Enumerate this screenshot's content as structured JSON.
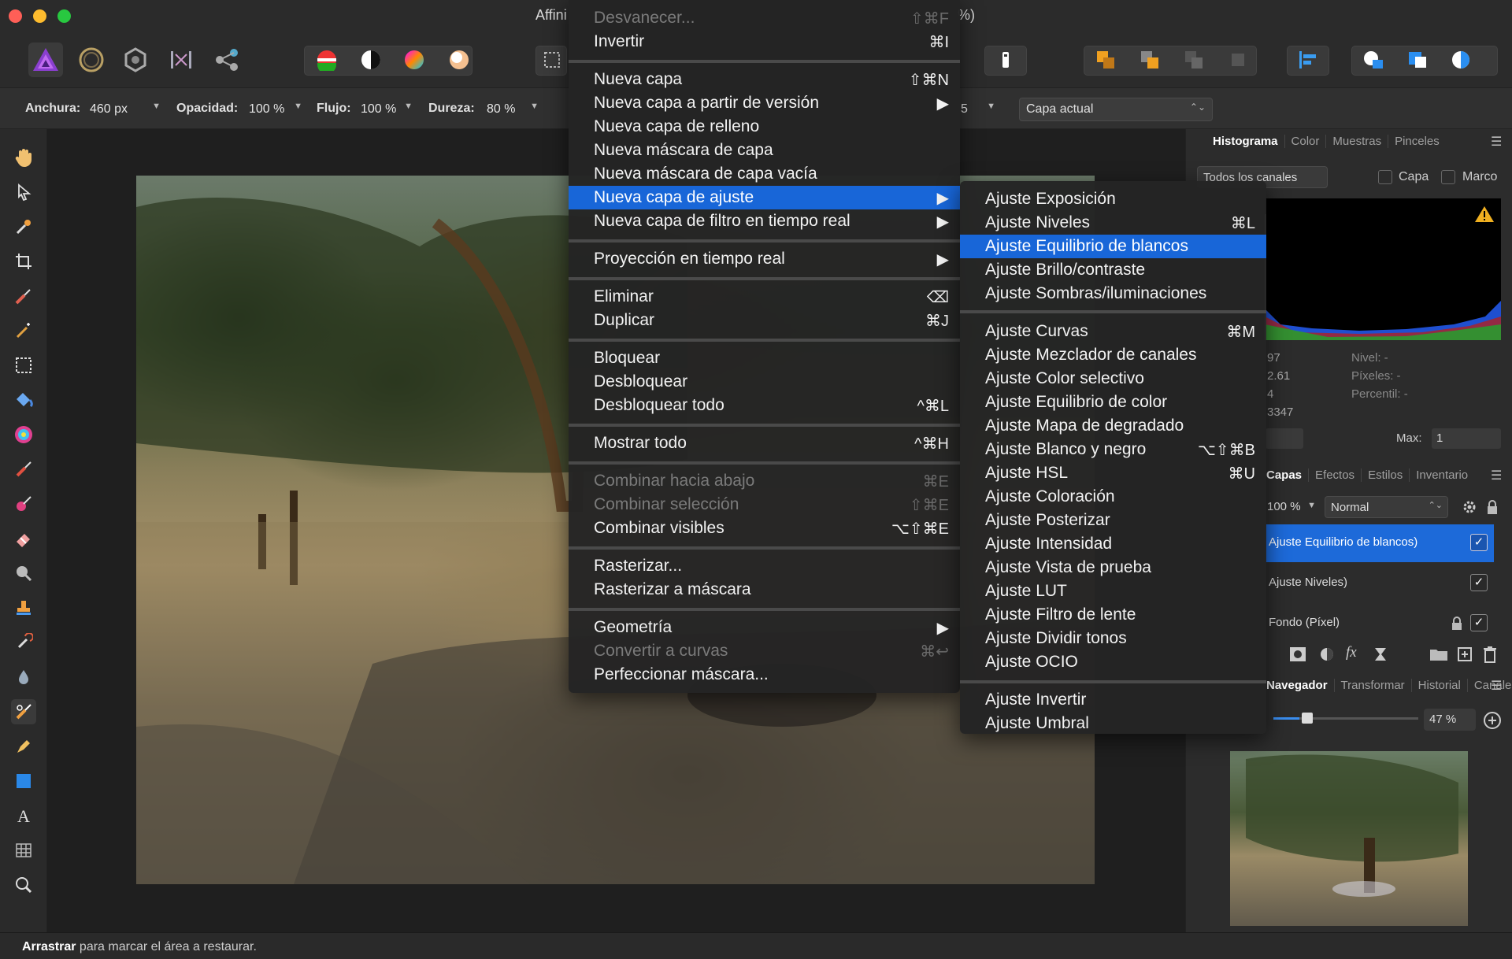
{
  "window": {
    "title_left": "Affini",
    "title_right": "%)"
  },
  "context_bar": {
    "width_label": "Anchura:",
    "width_value": "460 px",
    "opacity_label": "Opacidad:",
    "opacity_value": "100 %",
    "flow_label": "Flujo:",
    "flow_value": "100 %",
    "hardness_label": "Dureza:",
    "hardness_value": "80 %",
    "hidden_value": "5",
    "source_select": "Capa actual"
  },
  "main_menu": {
    "items": [
      {
        "label": "Desvanecer...",
        "shortcut": "⇧⌘F",
        "disabled": true
      },
      {
        "label": "Invertir",
        "shortcut": "⌘I"
      },
      {
        "label": "Nueva capa",
        "shortcut": "⇧⌘N"
      },
      {
        "label": "Nueva capa a partir de versión",
        "shortcut": "▶"
      },
      {
        "label": "Nueva capa de relleno",
        "shortcut": ""
      },
      {
        "label": "Nueva máscara de capa",
        "shortcut": ""
      },
      {
        "label": "Nueva máscara de capa vacía",
        "shortcut": ""
      },
      {
        "label": "Nueva capa de ajuste",
        "shortcut": "▶",
        "highlighted": true
      },
      {
        "label": "Nueva capa de filtro en tiempo real",
        "shortcut": "▶"
      },
      {
        "label": "Proyección en tiempo real",
        "shortcut": "▶"
      },
      {
        "label": "Eliminar",
        "shortcut": "⌫"
      },
      {
        "label": "Duplicar",
        "shortcut": "⌘J"
      },
      {
        "label": "Bloquear",
        "shortcut": ""
      },
      {
        "label": "Desbloquear",
        "shortcut": ""
      },
      {
        "label": "Desbloquear todo",
        "shortcut": "^⌘L"
      },
      {
        "label": "Mostrar todo",
        "shortcut": "^⌘H"
      },
      {
        "label": "Combinar hacia abajo",
        "shortcut": "⌘E",
        "disabled": true
      },
      {
        "label": "Combinar selección",
        "shortcut": "⇧⌘E",
        "disabled": true
      },
      {
        "label": "Combinar visibles",
        "shortcut": "⌥⇧⌘E"
      },
      {
        "label": "Rasterizar...",
        "shortcut": ""
      },
      {
        "label": "Rasterizar a máscara",
        "shortcut": ""
      },
      {
        "label": "Geometría",
        "shortcut": "▶"
      },
      {
        "label": "Convertir a curvas",
        "shortcut": "⌘↩",
        "disabled": true
      },
      {
        "label": "Perfeccionar máscara...",
        "shortcut": ""
      }
    ]
  },
  "sub_menu": {
    "items": [
      {
        "label": "Ajuste Exposición",
        "shortcut": ""
      },
      {
        "label": "Ajuste Niveles",
        "shortcut": "⌘L"
      },
      {
        "label": "Ajuste Equilibrio de blancos",
        "shortcut": "",
        "highlighted": true
      },
      {
        "label": "Ajuste Brillo/contraste",
        "shortcut": ""
      },
      {
        "label": "Ajuste Sombras/iluminaciones",
        "shortcut": ""
      },
      {
        "label": "Ajuste Curvas",
        "shortcut": "⌘M"
      },
      {
        "label": "Ajuste Mezclador de canales",
        "shortcut": ""
      },
      {
        "label": "Ajuste Color selectivo",
        "shortcut": ""
      },
      {
        "label": "Ajuste Equilibrio de color",
        "shortcut": ""
      },
      {
        "label": "Ajuste Mapa de degradado",
        "shortcut": ""
      },
      {
        "label": "Ajuste Blanco y negro",
        "shortcut": "⌥⇧⌘B"
      },
      {
        "label": "Ajuste HSL",
        "shortcut": "⌘U"
      },
      {
        "label": "Ajuste Coloración",
        "shortcut": ""
      },
      {
        "label": "Ajuste Posterizar",
        "shortcut": ""
      },
      {
        "label": "Ajuste Intensidad",
        "shortcut": ""
      },
      {
        "label": "Ajuste Vista de prueba",
        "shortcut": ""
      },
      {
        "label": "Ajuste LUT",
        "shortcut": ""
      },
      {
        "label": "Ajuste Filtro de lente",
        "shortcut": ""
      },
      {
        "label": "Ajuste Dividir tonos",
        "shortcut": ""
      },
      {
        "label": "Ajuste OCIO",
        "shortcut": ""
      },
      {
        "label": "Ajuste Invertir",
        "shortcut": ""
      },
      {
        "label": "Ajuste Umbral",
        "shortcut": ""
      }
    ]
  },
  "right_panel": {
    "top_tabs": [
      "Histograma",
      "Color",
      "Muestras",
      "Pinceles"
    ],
    "channels_select": "Todos los canales",
    "layer_check": "Capa",
    "frame_check": "Marco",
    "stats_left": [
      "97",
      "2.61",
      "4",
      "3347"
    ],
    "stats_right": [
      "Nivel: -",
      "Píxeles: -",
      "Percentil: -"
    ],
    "max_label": "Max:",
    "max_value": "1",
    "layer_tabs": [
      "Capas",
      "Efectos",
      "Estilos",
      "Inventario"
    ],
    "layer_opacity": "100 %",
    "blend_mode": "Normal",
    "layers": [
      {
        "name": "Ajuste Equilibrio de blancos)",
        "selected": true
      },
      {
        "name": "Ajuste Niveles)"
      },
      {
        "name": "Fondo (Píxel)",
        "locked": true
      }
    ],
    "bottom_tabs": [
      "Navegador",
      "Transformar",
      "Historial",
      "Canales"
    ],
    "zoom_value": "47 %",
    "zoom_fraction": 0.47
  },
  "status_bar": {
    "bold": "Arrastrar",
    "text": " para marcar el área a restaurar."
  },
  "colors": {
    "accent": "#1866d8",
    "menu_bg": "#242424",
    "panel_bg": "#2c2c2c"
  }
}
